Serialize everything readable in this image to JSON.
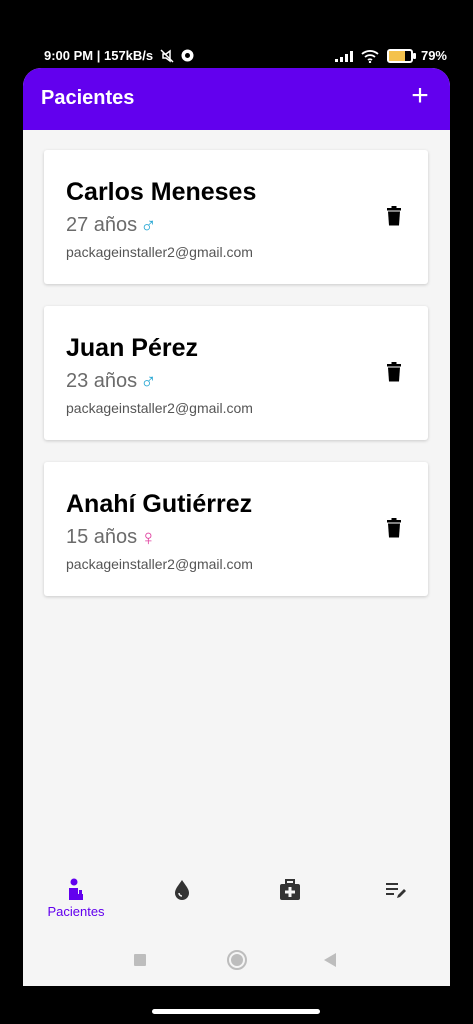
{
  "status": {
    "time_info": "9:00 PM | 157kB/s",
    "battery": "79%"
  },
  "app_bar": {
    "title": "Pacientes",
    "add_icon": "+"
  },
  "patients": [
    {
      "name": "Carlos Meneses",
      "age": "27 años",
      "gender": "♂",
      "gender_type": "male",
      "email": "packageinstaller2@gmail.com"
    },
    {
      "name": "Juan Pérez",
      "age": "23 años",
      "gender": "♂",
      "gender_type": "male",
      "email": "packageinstaller2@gmail.com"
    },
    {
      "name": "Anahí Gutiérrez",
      "age": "15 años",
      "gender": "♀",
      "gender_type": "female",
      "email": "packageinstaller2@gmail.com"
    }
  ],
  "bottom_nav": {
    "items": [
      {
        "label": "Pacientes",
        "icon": "patient-icon",
        "active": true
      },
      {
        "label": "",
        "icon": "drop-icon",
        "active": false
      },
      {
        "label": "",
        "icon": "medical-kit-icon",
        "active": false
      },
      {
        "label": "",
        "icon": "edit-list-icon",
        "active": false
      }
    ]
  },
  "colors": {
    "primary": "#6200ee",
    "male": "#2aa8d4",
    "female": "#e040a0"
  }
}
